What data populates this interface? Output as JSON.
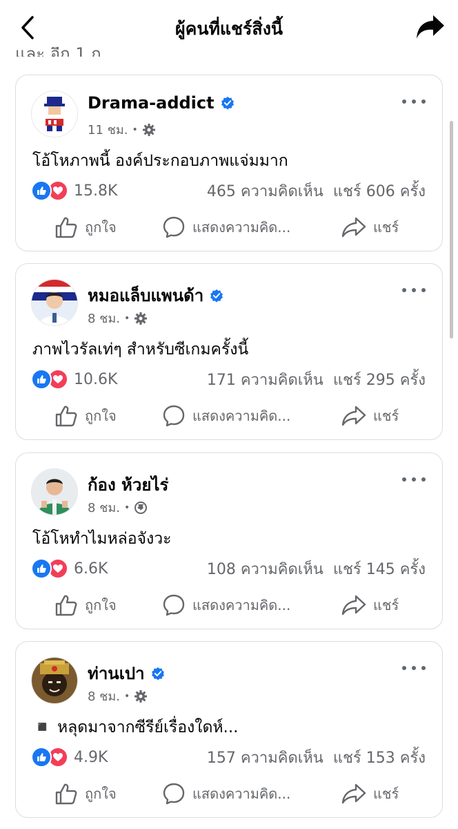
{
  "header": {
    "title": "ผู้คนที่แชร์สิ่งนี้"
  },
  "cut_off_text": "และ อีก 1 ก",
  "labels": {
    "like": "ถูกใจ",
    "comment": "แสดงความคิด...",
    "share": "แชร์"
  },
  "colors": {
    "accent": "#1877f2",
    "love": "#f33e58",
    "muted": "#65676b"
  },
  "posts": [
    {
      "author": "Drama-addict",
      "verified": true,
      "time": "11 ชม.",
      "audience_icon": "gear-icon",
      "text": "โอ้โหภาพนี้ องค์ประกอบภาพแจ่มมาก",
      "reaction_count": "15.8K",
      "comments": "465 ความคิดเห็น",
      "shares": "แชร์ 606 ครั้ง"
    },
    {
      "author": "หมอแล็บแพนด้า",
      "verified": true,
      "time": "8 ชม.",
      "audience_icon": "gear-icon",
      "text": "ภาพไวรัลเท่ๆ สำหรับซีเกมครั้งนี้",
      "reaction_count": "10.6K",
      "comments": "171 ความคิดเห็น",
      "shares": "แชร์ 295 ครั้ง"
    },
    {
      "author": "ก้อง ห้วยไร่",
      "verified": false,
      "time": "8 ชม.",
      "audience_icon": "globe-icon",
      "text": "โอ้โหทำไมหล่อจังวะ",
      "reaction_count": "6.6K",
      "comments": "108 ความคิดเห็น",
      "shares": "แชร์ 145 ครั้ง"
    },
    {
      "author": "ท่านเปา",
      "verified": true,
      "time": "8 ชม.",
      "audience_icon": "gear-icon",
      "text": "◾️ หลุดมาจากซีรีย์เรื่องใดห์...",
      "reaction_count": "4.9K",
      "comments": "157 ความคิดเห็น",
      "shares": "แชร์ 153 ครั้ง"
    }
  ]
}
